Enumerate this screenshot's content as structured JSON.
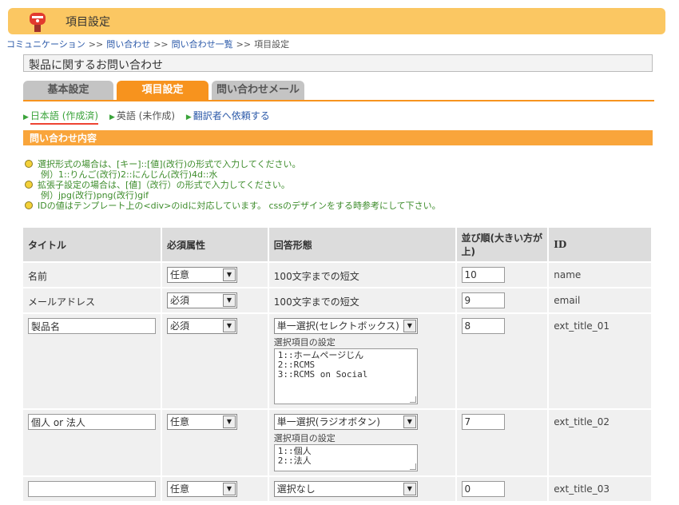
{
  "header": {
    "title": "項目設定",
    "icon": "mailbox-icon"
  },
  "breadcrumb": {
    "items": [
      "コミュニケーション",
      "問い合わせ",
      "問い合わせ一覧",
      "項目設定"
    ],
    "separator": ">>"
  },
  "form_title": "製品に関するお問い合わせ",
  "tabs": [
    {
      "label": "基本設定",
      "active": false
    },
    {
      "label": "項目設定",
      "active": true
    },
    {
      "label": "問い合わせメール",
      "active": false
    }
  ],
  "languages": [
    {
      "label": "日本語 (作成済)",
      "current": true
    },
    {
      "label": "英語 (未作成)",
      "current": false
    },
    {
      "label": "翻訳者へ依頼する",
      "current": false
    }
  ],
  "section_title": "問い合わせ内容",
  "notes": [
    {
      "text": "選択形式の場合は、[キー]::[値](改行)の形式で入力してください。",
      "example": "例）1::りんご(改行)2::にんじん(改行)4d::水"
    },
    {
      "text": "拡張子設定の場合は、[値]（改行）の形式で入力してください。",
      "example": "例）jpg(改行)png(改行)gif"
    },
    {
      "text": "IDの値はテンプレート上の<div>のidに対応しています。 cssのデザインをする時参考にして下さい。",
      "example": ""
    }
  ],
  "table": {
    "headers": {
      "title": "タイトル",
      "required": "必須属性",
      "answer_type": "回答形態",
      "order": "並び順(大きい方が上)",
      "id": "ID"
    },
    "option_label": "選択項目の設定",
    "rows": [
      {
        "title": "名前",
        "title_editable": false,
        "required": "任意",
        "answer_type": "100文字までの短文",
        "type_select": false,
        "options": "",
        "order": "10",
        "id": "name"
      },
      {
        "title": "メールアドレス",
        "title_editable": false,
        "required": "必須",
        "answer_type": "100文字までの短文",
        "type_select": false,
        "options": "",
        "order": "9",
        "id": "email"
      },
      {
        "title": "製品名",
        "title_editable": true,
        "required": "必須",
        "answer_type": "単一選択(セレクトボックス)",
        "type_select": true,
        "options": "1::ホームページじん\n2::RCMS\n3::RCMS on Social",
        "order": "8",
        "id": "ext_title_01"
      },
      {
        "title": "個人 or 法人",
        "title_editable": true,
        "required": "任意",
        "answer_type": "単一選択(ラジオボタン)",
        "type_select": true,
        "options": "1::個人\n2::法人",
        "order": "7",
        "id": "ext_title_02"
      },
      {
        "title": "",
        "title_editable": true,
        "required": "任意",
        "answer_type": "選択なし",
        "type_select": true,
        "options": "",
        "order": "0",
        "id": "ext_title_03"
      }
    ]
  },
  "colors": {
    "header_bg": "#fbc762",
    "accent": "#f7931e",
    "section_bar": "#f9a53b",
    "note_green": "#3d8c2b",
    "link_blue": "#2a58a8"
  }
}
